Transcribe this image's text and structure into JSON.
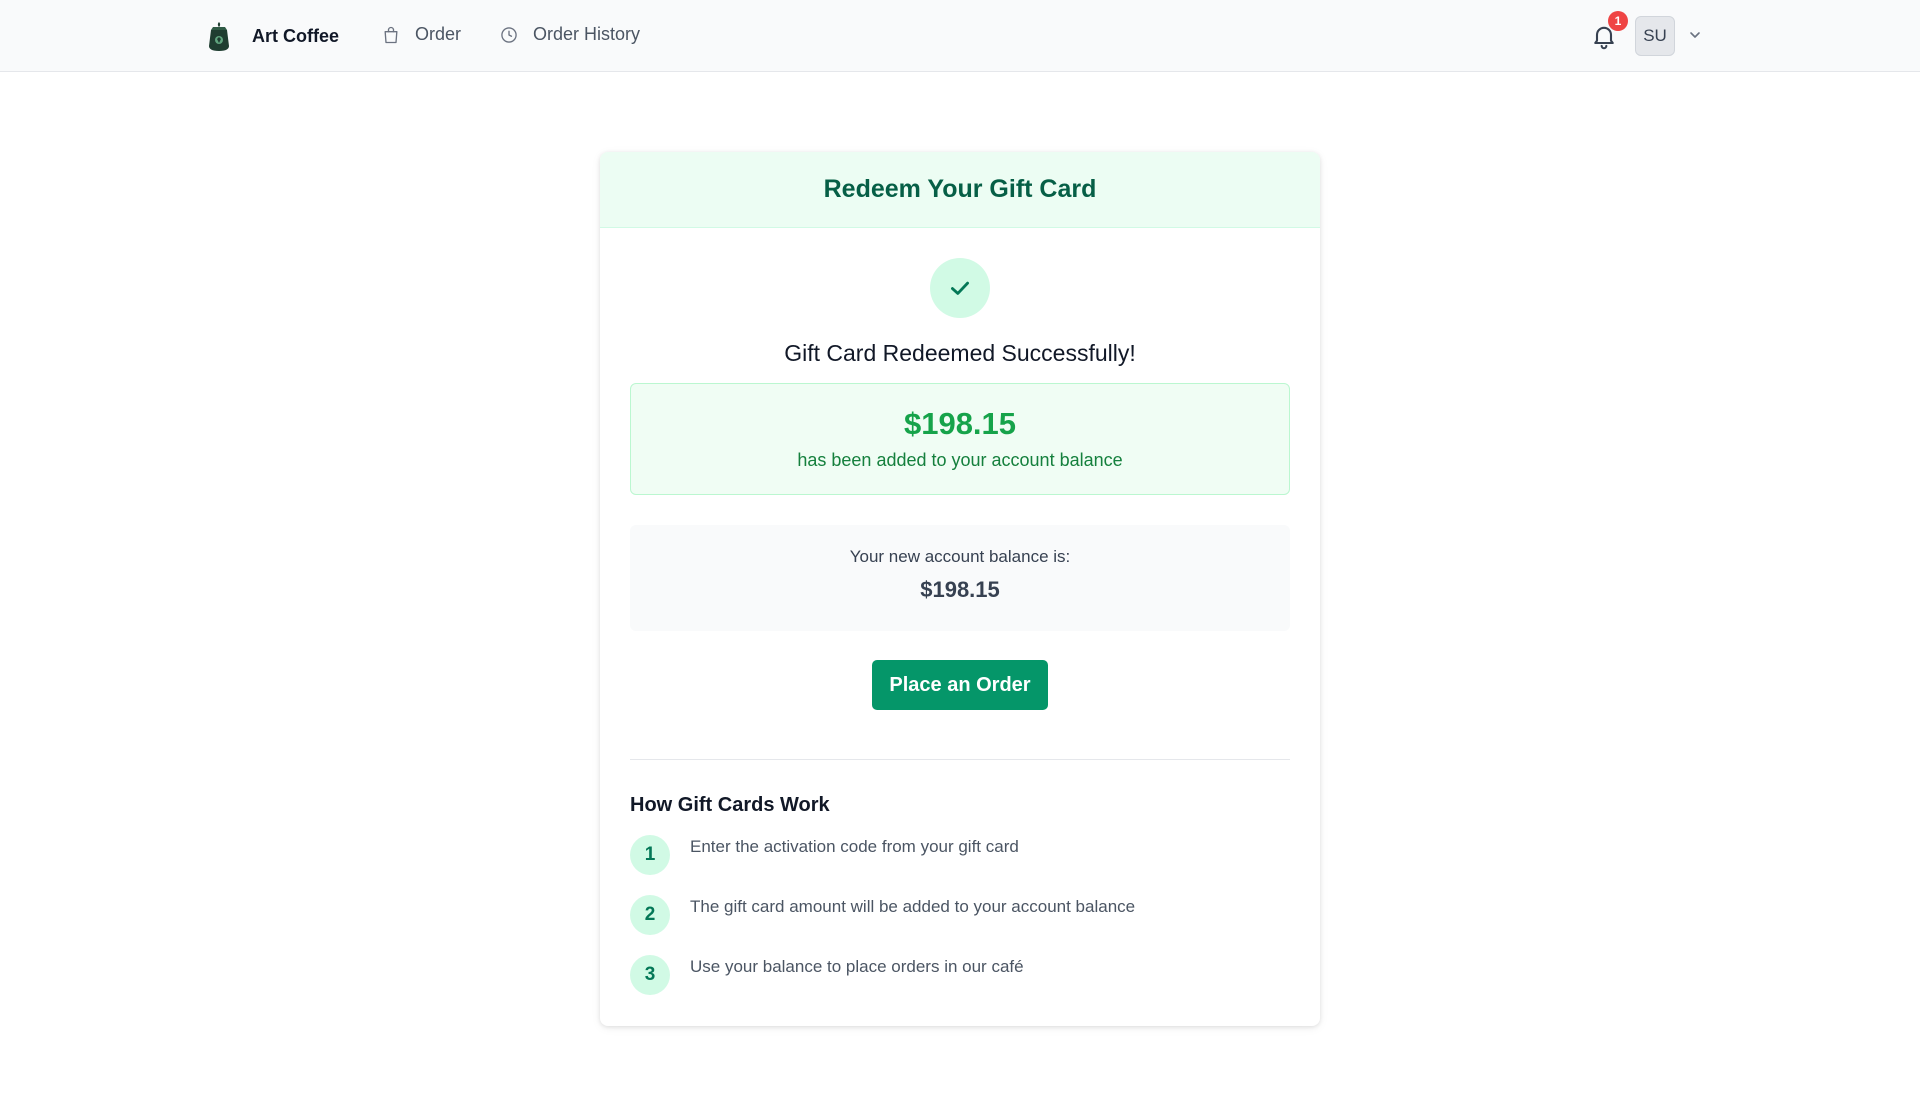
{
  "header": {
    "brand_name": "Art Coffee",
    "nav": [
      {
        "label": "Order",
        "icon": "shopping-bag-icon"
      },
      {
        "label": "Order History",
        "icon": "clock-icon"
      }
    ],
    "notifications": {
      "count": "1",
      "icon": "bell-icon"
    },
    "user": {
      "initials": "SU"
    }
  },
  "card": {
    "title": "Redeem Your Gift Card",
    "success_message": "Gift Card Redeemed Successfully!",
    "amount": "$198.15",
    "amount_note": "has been added to your account balance",
    "balance_label": "Your new account balance is:",
    "balance_value": "$198.15",
    "cta_label": "Place an Order",
    "how_title": "How Gift Cards Work",
    "steps": [
      {
        "number": "1",
        "text": "Enter the activation code from your gift card"
      },
      {
        "number": "2",
        "text": "The gift card amount will be added to your account balance"
      },
      {
        "number": "3",
        "text": "Use your balance to place orders in our café"
      }
    ]
  },
  "colors": {
    "accent": "#059669",
    "success_text": "#16a34a",
    "header_bg": "#ecfdf3",
    "badge": "#ef4444"
  }
}
